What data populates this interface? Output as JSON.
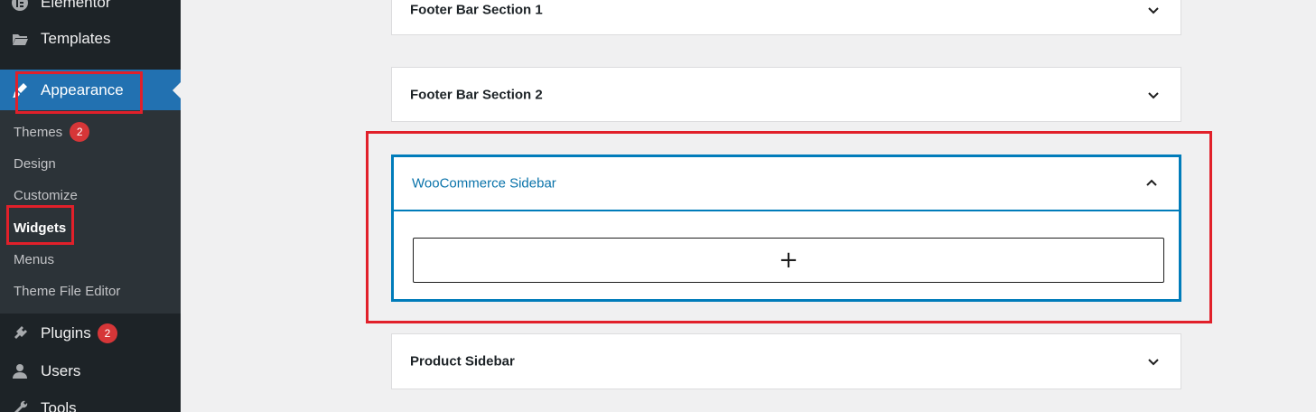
{
  "sidebar": {
    "items": {
      "elementor": {
        "label": "Elementor",
        "icon": "elementor-icon"
      },
      "templates": {
        "label": "Templates",
        "icon": "folder-icon"
      },
      "appearance": {
        "label": "Appearance",
        "icon": "brush-icon"
      },
      "plugins": {
        "label": "Plugins",
        "icon": "plugin-icon",
        "badge": "2"
      },
      "users": {
        "label": "Users",
        "icon": "user-icon"
      },
      "tools": {
        "label": "Tools",
        "icon": "wrench-icon"
      }
    },
    "submenu": {
      "themes": {
        "label": "Themes",
        "badge": "2"
      },
      "design": {
        "label": "Design"
      },
      "customize": {
        "label": "Customize"
      },
      "widgets": {
        "label": "Widgets"
      },
      "menus": {
        "label": "Menus"
      },
      "theme_file_editor": {
        "label": "Theme File Editor"
      }
    }
  },
  "widget_areas": {
    "footer_bar_1": {
      "title": "Footer Bar Section 1",
      "expanded": false
    },
    "footer_bar_2": {
      "title": "Footer Bar Section 2",
      "expanded": false
    },
    "woocommerce_sidebar": {
      "title": "WooCommerce Sidebar",
      "expanded": true,
      "add_block_symbol": "+"
    },
    "product_sidebar": {
      "title": "Product Sidebar",
      "expanded": false
    }
  },
  "colors": {
    "sidebar_bg": "#1d2327",
    "submenu_bg": "#2c3338",
    "accent": "#2271b1",
    "open_panel_border": "#007cba",
    "highlight": "#e1202a",
    "badge": "#d63638"
  }
}
